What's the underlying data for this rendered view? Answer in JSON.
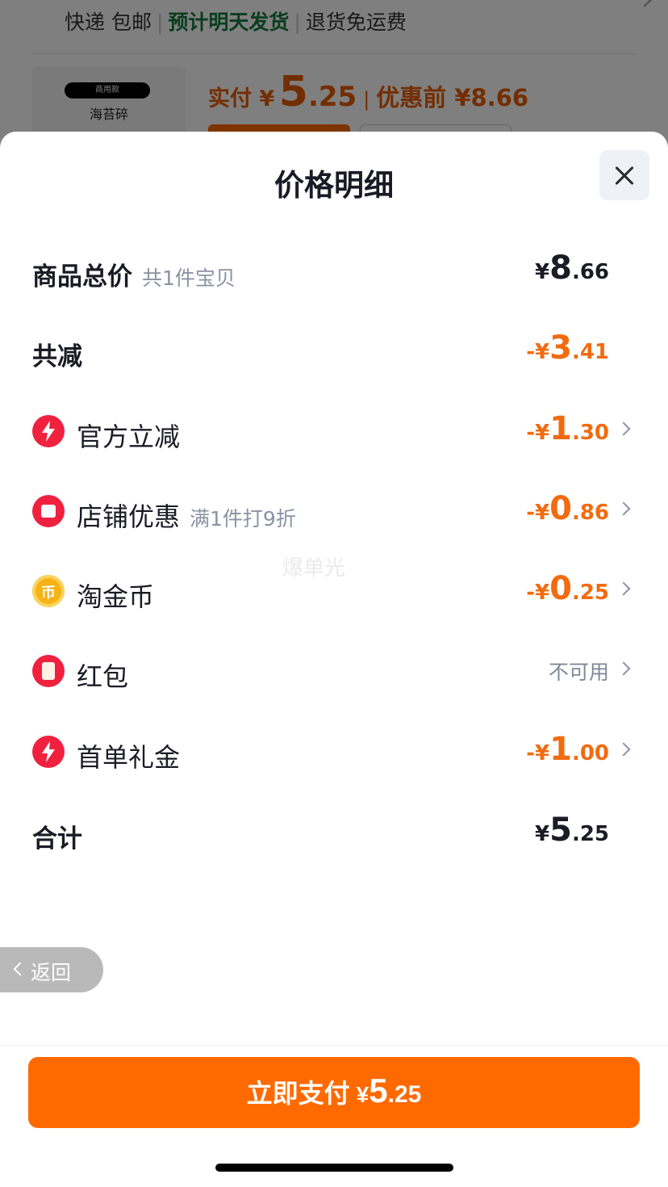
{
  "background": {
    "shipping_a": "快递 包邮",
    "shipping_eta": "预计明天发货",
    "shipping_b": "退货免运费",
    "thumb_tag": "商用款",
    "thumb_name": "海苔碎",
    "pay_label": "实付 ¥",
    "pay_int": "5",
    "pay_dec": ".25",
    "before_label": "优惠前 ¥8.66"
  },
  "sheet": {
    "title": "价格明细",
    "watermark": "爆单光",
    "back_label": "返回"
  },
  "rows": {
    "total": {
      "label": "商品总价",
      "sub": "共1件宝贝",
      "currency": "¥",
      "int": "8",
      "dec": ".66"
    },
    "reduced": {
      "label": "共减",
      "currency": "-¥",
      "int": "3",
      "dec": ".41"
    },
    "official": {
      "label": "官方立减",
      "currency": "-¥",
      "int": "1",
      "dec": ".30"
    },
    "shop": {
      "label": "店铺优惠",
      "sub": "满1件打9折",
      "currency": "-¥",
      "int": "0",
      "dec": ".86"
    },
    "coins": {
      "label": "淘金币",
      "icon_text": "币",
      "currency": "-¥",
      "int": "0",
      "dec": ".25"
    },
    "redpacket": {
      "label": "红包",
      "status": "不可用"
    },
    "firstorder": {
      "label": "首单礼金",
      "currency": "-¥",
      "int": "1",
      "dec": ".00"
    },
    "sum": {
      "label": "合计",
      "currency": "¥",
      "int": "5",
      "dec": ".25"
    }
  },
  "pay_button": {
    "label": "立即支付",
    "currency": "¥",
    "int": "5",
    "dec": ".25"
  },
  "colors": {
    "accent": "#ff6a00",
    "discount": "#f26b0f",
    "icon_red": "#f0213f",
    "green": "#137a3a"
  },
  "icons": {
    "close": "close-icon",
    "official": "lightning-icon",
    "shop": "shop-icon",
    "coins": "coin-icon",
    "redpacket": "red-envelope-icon",
    "firstorder": "lightning-icon"
  }
}
